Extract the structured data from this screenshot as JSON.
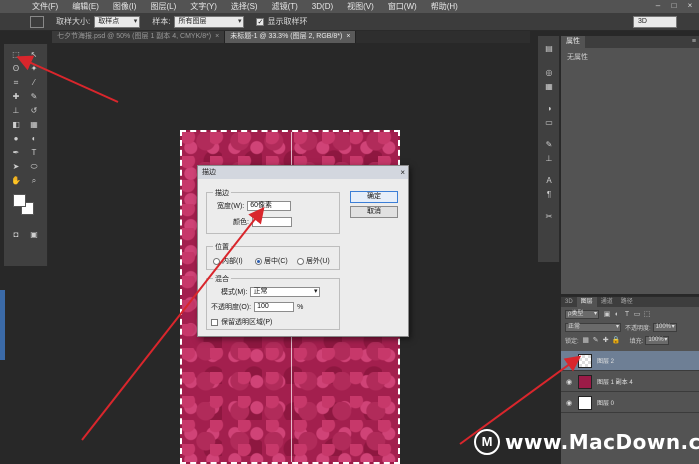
{
  "menubar": {
    "items": [
      "文件(F)",
      "编辑(E)",
      "图像(I)",
      "图层(L)",
      "文字(Y)",
      "选择(S)",
      "滤镜(T)",
      "3D(D)",
      "视图(V)",
      "窗口(W)",
      "帮助(H)"
    ],
    "window_controls": [
      "–",
      "□",
      "×"
    ]
  },
  "options": {
    "sample_size_label": "取样大小:",
    "sample_size_value": "取样点",
    "sample_label": "样本:",
    "sample_value": "所有图层",
    "show_ring_label": "显示取样环",
    "show_ring_checked": "✓",
    "workspace": "3D"
  },
  "tabs": [
    {
      "label": "七夕节海报.psd @ 50% (图层 1 副本 4, CMYK/8*)",
      "close": "×"
    },
    {
      "label": "未标题-1 @ 33.3% (图层 2, RGB/8*)",
      "close": "×"
    }
  ],
  "dialog": {
    "title": "描边",
    "close": "×",
    "stroke_group_title": "描边",
    "width_label": "宽度(W):",
    "width_value": "60像素",
    "color_label": "颜色:",
    "position_group_title": "位置",
    "position_inside": "内部(I)",
    "position_center": "居中(C)",
    "position_outside": "居外(U)",
    "blend_group_title": "混合",
    "mode_label": "模式(M):",
    "mode_value": "正常",
    "opacity_label": "不透明度(O):",
    "opacity_value": "100",
    "opacity_unit": "%",
    "preserve_label": "保留透明区域(P)",
    "ok_label": "确定",
    "cancel_label": "取消"
  },
  "properties": {
    "tab_label": "属性",
    "content": "无属性",
    "menu": "≡"
  },
  "layers": {
    "tabs": [
      "3D",
      "图层",
      "通道",
      "路径"
    ],
    "filter_label": "ρ类型",
    "blend_mode": "正常",
    "opacity_label": "不透明度:",
    "opacity_value": "100%",
    "lock_label": "锁定:",
    "fill_label": "填充:",
    "fill_value": "100%",
    "items": [
      {
        "name": "图层 2"
      },
      {
        "name": "图层 1 副本 4"
      },
      {
        "name": "图层 0"
      }
    ]
  },
  "watermark": {
    "logo": "M",
    "text": "www.MacDown.com"
  },
  "colors": {
    "annotation_red": "#d9262c",
    "accent_orange": "#ff5b1f",
    "selected_layer": "#6e7f95"
  }
}
